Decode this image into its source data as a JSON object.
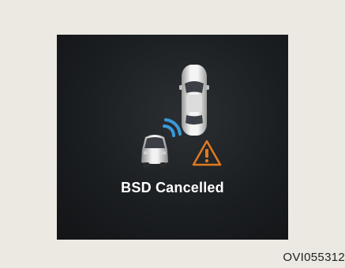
{
  "status": {
    "message": "BSD Cancelled"
  },
  "figure": {
    "code": "OVI055312"
  },
  "icons": {
    "vehicle": "car-top-icon",
    "rear_vehicle": "car-rear-icon",
    "sensor": "radar-wave-icon",
    "alert": "warning-triangle-icon"
  },
  "colors": {
    "background": "#ebe9e2",
    "panel": "#1b1e21",
    "radar": "#3a9ad9",
    "warning": "#e07a1f",
    "text": "#ffffff"
  }
}
